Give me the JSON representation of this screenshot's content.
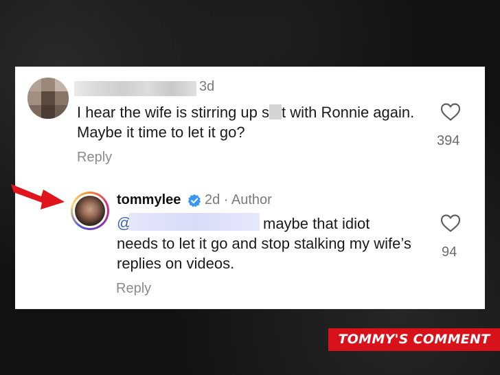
{
  "comment1": {
    "timestamp": "3d",
    "text_before": "I hear the wife is stirring up s",
    "text_after": "t with Ronnie again. Maybe it time to let it go?",
    "reply_label": "Reply",
    "likes": "394"
  },
  "comment2": {
    "username": "tommylee",
    "meta": "2d · Author",
    "mention_prefix": "@",
    "text_line1": "maybe that idiot",
    "text_rest": "needs to let it go and stop stalking my wife’s replies on videos.",
    "reply_label": "Reply",
    "likes": "94"
  },
  "caption": "TOMMY'S COMMENT",
  "colors": {
    "arrow": "#e0141b",
    "caption_bg": "#d8121b",
    "verified": "#3897f0",
    "mention": "#3a5fb8"
  },
  "icons": [
    "heart-outline-icon",
    "verified-badge-icon",
    "red-arrow-icon"
  ]
}
